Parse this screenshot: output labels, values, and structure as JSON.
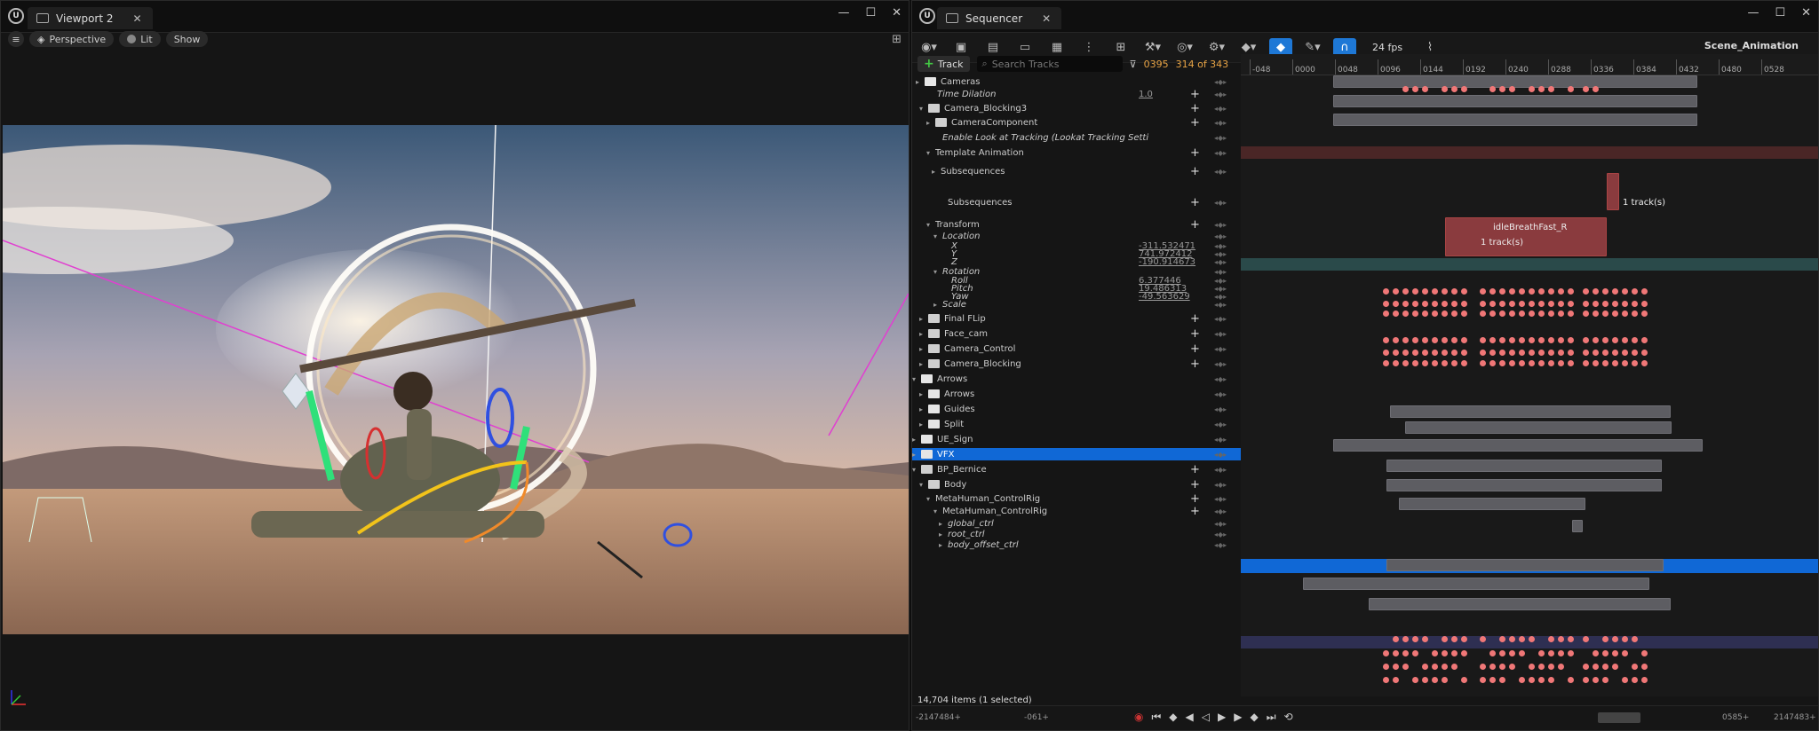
{
  "viewport": {
    "tab_label": "Viewport 2",
    "toolbar": {
      "perspective": "Perspective",
      "lit": "Lit",
      "show": "Show"
    }
  },
  "sequencer": {
    "tab_label": "Sequencer",
    "fps": "24 fps",
    "scene_name": "Scene_Animation",
    "track_button": "Track",
    "search_placeholder": "Search Tracks",
    "current_frame": "0395",
    "track_count": "314 of 343",
    "playhead_label": "0395",
    "ruler_ticks": [
      "-048",
      "0000",
      "0048",
      "0096",
      "0144",
      "0192",
      "0240",
      "0288",
      "0336",
      "0384",
      "0432",
      "0480",
      "0528"
    ],
    "status": "14,704 items (1 selected)",
    "range_start": "-2147484+",
    "range_in": "-061+",
    "range_out": "0585+",
    "range_end": "2147483+",
    "section_labels": {
      "idle_name": "idleBreathFast_R",
      "tracks_a": "1 track(s)",
      "tracks_b": "1 track(s)"
    },
    "rows": [
      {
        "label": "Cameras"
      },
      {
        "label": "Time Dilation",
        "value": "1.0"
      },
      {
        "label": "Camera_Blocking3"
      },
      {
        "label": "CameraComponent"
      },
      {
        "label": "Enable Look at Tracking (Lookat Tracking Setti"
      },
      {
        "label": "Template Animation"
      },
      {
        "label": "Subsequences"
      },
      {
        "label": "Subsequences"
      },
      {
        "label": "Transform"
      },
      {
        "label": "Location"
      },
      {
        "label": "X",
        "value": "-311.532471"
      },
      {
        "label": "Y",
        "value": "741.972412"
      },
      {
        "label": "Z",
        "value": "-190.914673"
      },
      {
        "label": "Rotation"
      },
      {
        "label": "Roll",
        "value": "6.377446"
      },
      {
        "label": "Pitch",
        "value": "19.486313"
      },
      {
        "label": "Yaw",
        "value": "-49.563629"
      },
      {
        "label": "Scale"
      },
      {
        "label": "Final FLip"
      },
      {
        "label": "Face_cam"
      },
      {
        "label": "Camera_Control"
      },
      {
        "label": "Camera_Blocking"
      },
      {
        "label": "Arrows"
      },
      {
        "label": "Arrows"
      },
      {
        "label": "Guides"
      },
      {
        "label": "Split"
      },
      {
        "label": "UE_Sign"
      },
      {
        "label": "VFX"
      },
      {
        "label": "BP_Bernice"
      },
      {
        "label": "Body"
      },
      {
        "label": "MetaHuman_ControlRig"
      },
      {
        "label": "MetaHuman_ControlRig"
      },
      {
        "label": "global_ctrl"
      },
      {
        "label": "root_ctrl"
      },
      {
        "label": "body_offset_ctrl"
      }
    ]
  }
}
